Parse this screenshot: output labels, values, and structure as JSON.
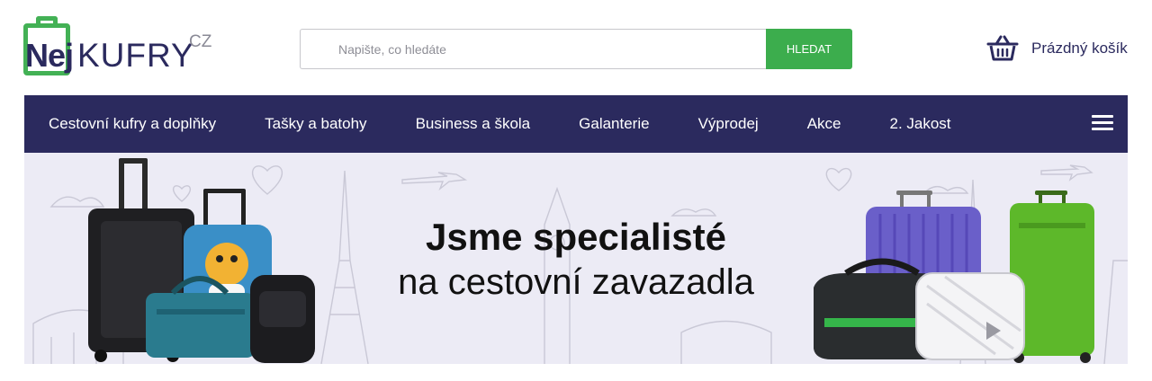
{
  "logo": {
    "nej": "Nej",
    "kufry": "KUFRY",
    "cz": "CZ"
  },
  "search": {
    "placeholder": "Napište, co hledáte",
    "button_label": "HLEDAT"
  },
  "cart": {
    "label": "Prázdný košík",
    "icon": "basket-icon"
  },
  "nav": {
    "items": [
      {
        "label": "Cestovní kufry a doplňky"
      },
      {
        "label": "Tašky a batohy"
      },
      {
        "label": "Business a škola"
      },
      {
        "label": "Galanterie"
      },
      {
        "label": "Výprodej"
      },
      {
        "label": "Akce"
      },
      {
        "label": "2. Jakost"
      }
    ],
    "menu_icon": "hamburger-icon"
  },
  "banner": {
    "headline": "Jsme specialisté",
    "subline": "na cestovní zavazadla"
  },
  "colors": {
    "brand_navy": "#2b2a5e",
    "brand_green": "#3cad4d",
    "banner_bg": "#ecebf5"
  }
}
